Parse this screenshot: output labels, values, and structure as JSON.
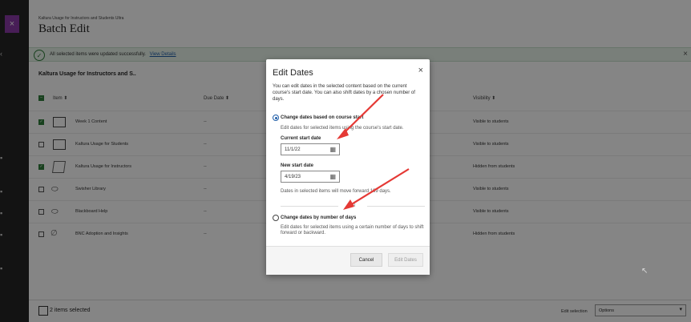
{
  "panel": {
    "breadcrumb": "Kaltura Usage for Instructors and Students Ultra",
    "title": "Batch Edit",
    "close_icon": "×"
  },
  "banner": {
    "message": "All selected items were updated successfully.",
    "link": "View Details",
    "close_icon": "×"
  },
  "course_title": "Kaltura Usage for Instructors and S..",
  "table": {
    "columns": [
      "Item ⬍",
      "Due Date ⬍",
      "Visibility ⬍"
    ],
    "rows": [
      {
        "name": "Week 1 Content",
        "due": "--",
        "visibility": "Visible to students",
        "checked": true
      },
      {
        "name": "Kaltura Usage for Students",
        "due": "--",
        "visibility": "Visible to students",
        "checked": false
      },
      {
        "name": "Kaltura Usage for Instructors",
        "due": "--",
        "visibility": "Hidden from students",
        "checked": true
      },
      {
        "name": "Swisher Library",
        "due": "--",
        "visibility": "Visible to students",
        "checked": false
      },
      {
        "name": "Blackboard Help",
        "due": "--",
        "visibility": "Visible to students",
        "checked": false
      },
      {
        "name": "BNC Adoption and Insights",
        "due": "--",
        "visibility": "Hidden from students",
        "checked": false
      }
    ]
  },
  "footer": {
    "selected_text": "2 items selected",
    "edit_selection_label": "Edit selection",
    "select_value": "Options"
  },
  "modal": {
    "title": "Edit Dates",
    "close_icon": "×",
    "description": "You can edit dates in the selected content based on the current course's start date. You can also shift dates by a chosen number of days.",
    "option1": {
      "label": "Change dates based on course start",
      "help": "Edit dates for selected items using the course's start date."
    },
    "current_start_label": "Current start date",
    "current_start_value": "11/1/22",
    "new_start_label": "New start date",
    "new_start_value": "4/19/23",
    "move_note": "Dates in selected items will move forward 169 days.",
    "or_text": "OR",
    "option2": {
      "label": "Change dates by number of days",
      "help": "Edit dates for selected items using a certain number of days to shift forward or backward."
    },
    "cancel_label": "Cancel",
    "edit_label": "Edit Dates"
  },
  "colors": {
    "accent": "#8b3aa7",
    "success": "#2f7d3a",
    "link": "#1f5da8",
    "annotation": "#e53935"
  }
}
